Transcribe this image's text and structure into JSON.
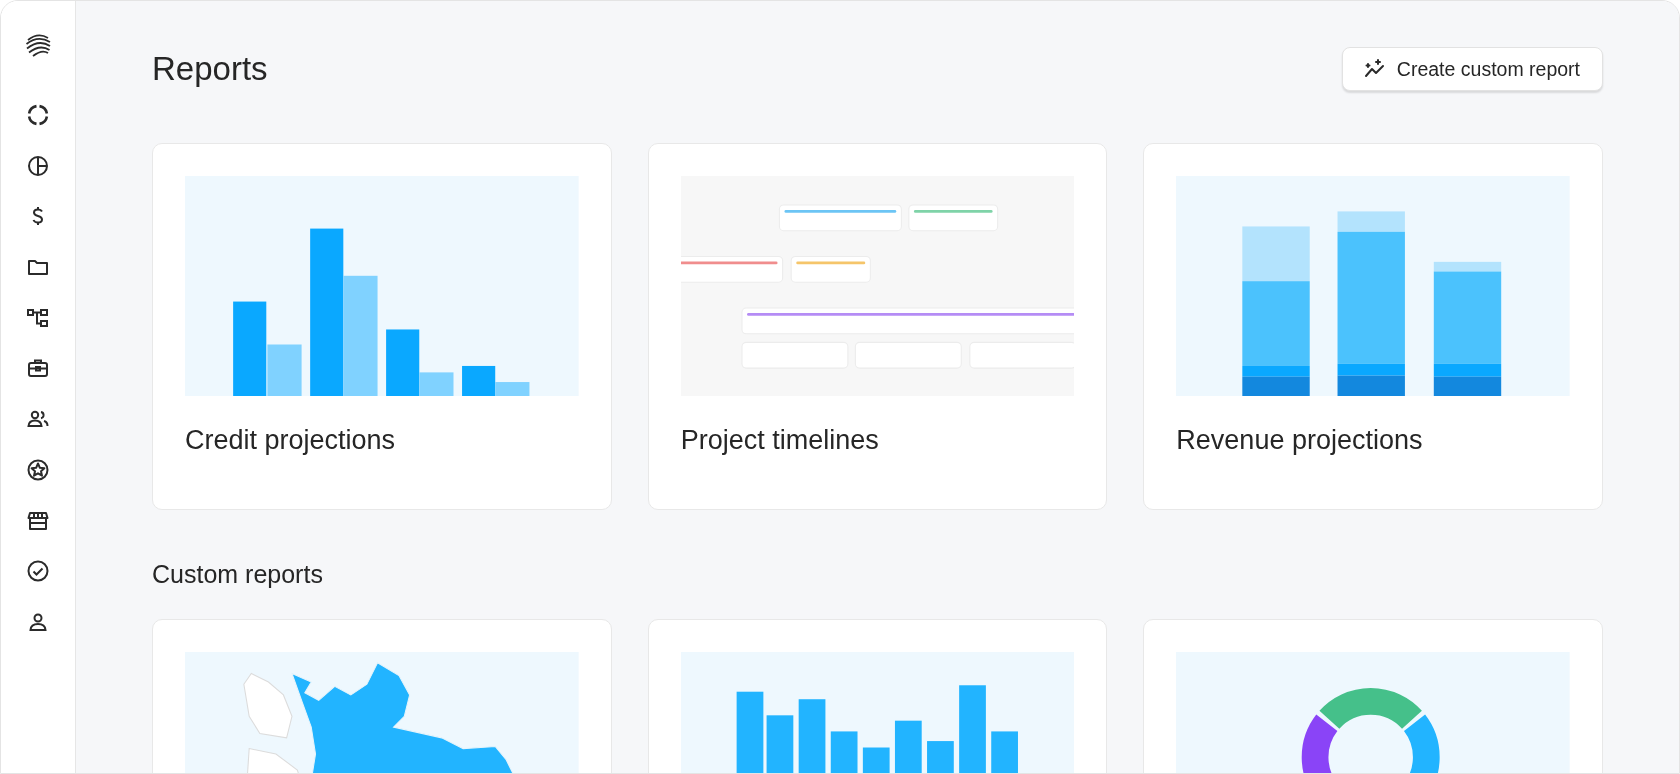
{
  "page": {
    "title": "Reports",
    "action_button": "Create custom report"
  },
  "report_templates": [
    {
      "title": "Credit projections",
      "kind": "grouped-bars"
    },
    {
      "title": "Project timelines",
      "kind": "timeline"
    },
    {
      "title": "Revenue projections",
      "kind": "stacked-bars"
    }
  ],
  "custom_reports": {
    "heading": "Custom reports",
    "cards": [
      {
        "kind": "map"
      },
      {
        "kind": "bars"
      },
      {
        "kind": "donut"
      }
    ]
  }
}
